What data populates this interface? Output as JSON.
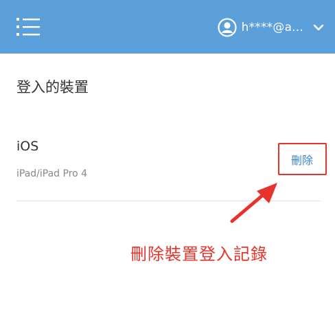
{
  "header": {
    "email": "h****@a...",
    "bar_color": "#5b9fdb",
    "menu_icon": "hamburger-list-icon",
    "avatar_icon": "user-circle-icon",
    "dropdown_icon": "chevron-down-icon"
  },
  "page": {
    "title": "登入的裝置"
  },
  "device": {
    "name": "iOS",
    "model": "iPad/iPad Pro 4",
    "delete_label": "刪除"
  },
  "annotation": {
    "text": "刪除裝置登入記錄",
    "color": "#e8332a"
  }
}
